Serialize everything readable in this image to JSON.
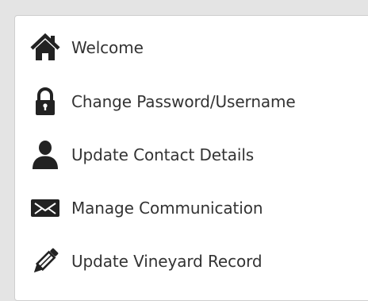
{
  "colors": {
    "background": "#e4e4e4",
    "panel": "#ffffff",
    "border": "#cfcfcf",
    "icon": "#222222",
    "text": "#333333"
  },
  "menu": {
    "items": [
      {
        "label": "Welcome",
        "icon": "home-icon"
      },
      {
        "label": "Change Password/Username",
        "icon": "lock-icon"
      },
      {
        "label": "Update Contact Details",
        "icon": "user-icon"
      },
      {
        "label": "Manage Communication",
        "icon": "envelope-icon"
      },
      {
        "label": "Update Vineyard Record",
        "icon": "pencil-icon"
      }
    ]
  }
}
